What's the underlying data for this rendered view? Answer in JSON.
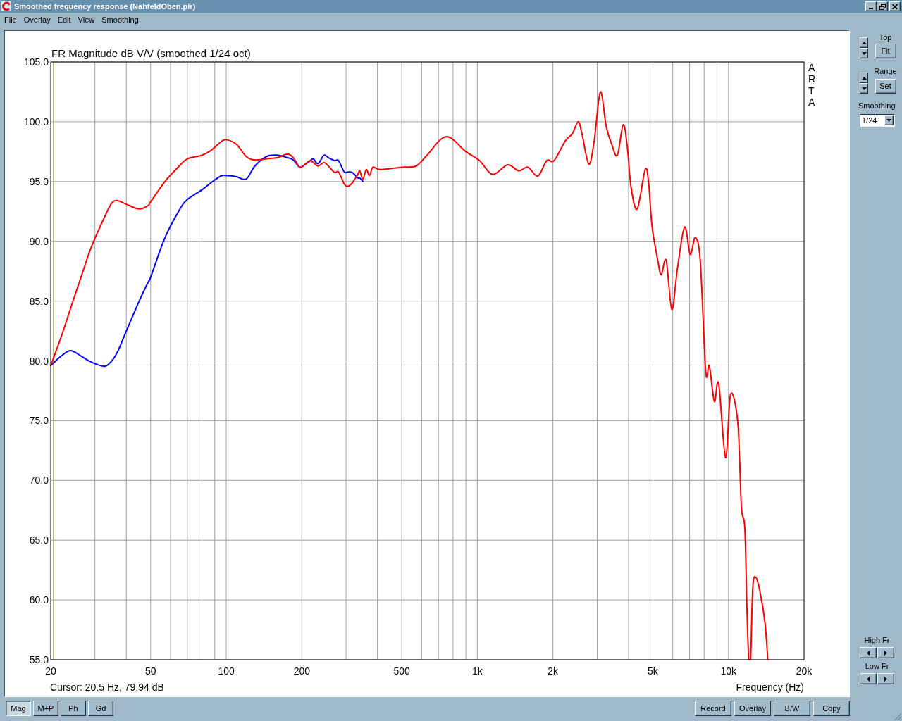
{
  "window": {
    "title": "Smoothed frequency response (NahfeldOben.pir)"
  },
  "menu": [
    "File",
    "Overlay",
    "Edit",
    "View",
    "Smoothing"
  ],
  "chart": {
    "logo": "ARTA",
    "cursor_readout": "Cursor: 20.5 Hz, 79.94 dB",
    "chart_data": {
      "type": "line",
      "title": "FR Magnitude dB V/V (smoothed 1/24 oct)",
      "xlabel": "Frequency (Hz)",
      "log": "x",
      "grid": true,
      "xlim": [
        20,
        20000
      ],
      "ylim": [
        55,
        105
      ],
      "xticks": [
        {
          "value": 20,
          "label": "20"
        },
        {
          "value": 50,
          "label": "50"
        },
        {
          "value": 100,
          "label": "100"
        },
        {
          "value": 200,
          "label": "200"
        },
        {
          "value": 500,
          "label": "500"
        },
        {
          "value": 1000,
          "label": "1k"
        },
        {
          "value": 2000,
          "label": "2k"
        },
        {
          "value": 5000,
          "label": "5k"
        },
        {
          "value": 10000,
          "label": "10k"
        },
        {
          "value": 20000,
          "label": "20k"
        }
      ],
      "yticks": [
        {
          "value": 105,
          "label": "105.0"
        },
        {
          "value": 100,
          "label": "100.0"
        },
        {
          "value": 95,
          "label": "95.0"
        },
        {
          "value": 90,
          "label": "90.0"
        },
        {
          "value": 85,
          "label": "85.0"
        },
        {
          "value": 80,
          "label": "80.0"
        },
        {
          "value": 75,
          "label": "75.0"
        },
        {
          "value": 70,
          "label": "70.0"
        },
        {
          "value": 65,
          "label": "65.0"
        },
        {
          "value": 60,
          "label": "60.0"
        },
        {
          "value": 55,
          "label": "55.0"
        }
      ],
      "ref_lines": [
        {
          "axis": "x",
          "value": 20.5
        }
      ],
      "x": [
        20,
        22,
        24,
        26.4,
        29,
        32.7,
        35,
        37,
        40,
        45,
        48.9,
        50,
        57,
        65,
        70,
        80,
        87,
        95,
        100,
        110,
        120,
        130,
        145,
        160,
        175,
        185,
        196,
        205,
        215,
        222,
        232,
        245,
        255,
        270,
        280,
        295,
        305,
        318,
        334,
        340,
        350,
        361,
        372,
        384,
        410,
        500,
        570,
        630,
        750,
        900,
        1020,
        1150,
        1320,
        1460,
        1590,
        1740,
        1890,
        2020,
        2240,
        2390,
        2520,
        2610,
        2780,
        2920,
        3090,
        3260,
        3430,
        3610,
        3810,
        3960,
        4090,
        4330,
        4660,
        4810,
        4960,
        5230,
        5400,
        5650,
        5950,
        6270,
        6690,
        7040,
        7370,
        7720,
        8120,
        8390,
        8790,
        9140,
        9740,
        10200,
        10900,
        11260,
        11620,
        11860,
        12050,
        12250,
        12500,
        12840,
        13350,
        13980,
        14350
      ],
      "series": [
        {
          "color": "#0000ff",
          "values": [
            79.6,
            80.4,
            80.85,
            80.4,
            79.9,
            79.55,
            80.0,
            80.8,
            82.5,
            85.0,
            86.6,
            87.0,
            90.3,
            92.6,
            93.5,
            94.3,
            94.9,
            95.45,
            95.5,
            95.4,
            95.2,
            96.3,
            97.1,
            97.2,
            97.0,
            96.8,
            96.2,
            96.4,
            96.7,
            96.9,
            96.5,
            97.2,
            97.0,
            96.75,
            96.75,
            95.8,
            95.8,
            95.75,
            95.3,
            95.3,
            95.0,
            null,
            null,
            null,
            null,
            null,
            null,
            null,
            null,
            null,
            null,
            null,
            null,
            null,
            null,
            null,
            null,
            null,
            null,
            null,
            null,
            null,
            null,
            null,
            null,
            null,
            null,
            null,
            null,
            null,
            null,
            null,
            null,
            null,
            null,
            null,
            null,
            null,
            null,
            null,
            null,
            null,
            null,
            null,
            null,
            null,
            null,
            null,
            null,
            null,
            null,
            null,
            null,
            null,
            null,
            null,
            null,
            null,
            null,
            null,
            null
          ]
        },
        {
          "color": "#ff0000",
          "values": [
            79.6,
            82.0,
            84.4,
            87.0,
            89.5,
            92.0,
            93.2,
            93.4,
            93.1,
            92.7,
            93.0,
            93.3,
            95.0,
            96.3,
            96.9,
            97.2,
            97.6,
            98.3,
            98.5,
            98.1,
            97.1,
            96.8,
            96.9,
            97.0,
            97.3,
            97.0,
            96.2,
            96.4,
            96.75,
            96.6,
            96.3,
            96.6,
            96.3,
            95.75,
            95.8,
            94.8,
            94.6,
            94.9,
            95.6,
            95.9,
            95.2,
            96.0,
            95.5,
            96.2,
            96.0,
            96.2,
            96.3,
            97.2,
            98.75,
            97.5,
            96.75,
            95.6,
            96.4,
            95.9,
            96.2,
            95.45,
            96.75,
            96.75,
            98.4,
            99.0,
            100.0,
            99.0,
            96.45,
            98.4,
            102.5,
            99.6,
            98.1,
            97.2,
            99.75,
            97.8,
            94.6,
            92.7,
            96.0,
            94.9,
            91.3,
            88.4,
            87.2,
            88.4,
            84.3,
            87.8,
            91.2,
            88.9,
            90.3,
            88.4,
            79.1,
            79.6,
            76.6,
            78.1,
            71.9,
            77.2,
            74.8,
            67.8,
            66.0,
            59.0,
            55.0,
            55.0,
            61.0,
            61.9,
            60.7,
            58.1,
            55.0
          ]
        }
      ]
    }
  },
  "side_panel": {
    "top": {
      "label": "Top",
      "button": "Fit"
    },
    "range": {
      "label": "Range",
      "button": "Set"
    },
    "smoothing": {
      "label": "Smoothing",
      "value": "1/24"
    },
    "high_fr": {
      "label": "High Fr"
    },
    "low_fr": {
      "label": "Low Fr"
    }
  },
  "view_tabs": [
    {
      "label": "Mag",
      "selected": true
    },
    {
      "label": "M+P",
      "selected": false
    },
    {
      "label": "Ph",
      "selected": false
    },
    {
      "label": "Gd",
      "selected": false
    }
  ],
  "actions": [
    "Record",
    "Overlay",
    "B/W",
    "Copy"
  ]
}
